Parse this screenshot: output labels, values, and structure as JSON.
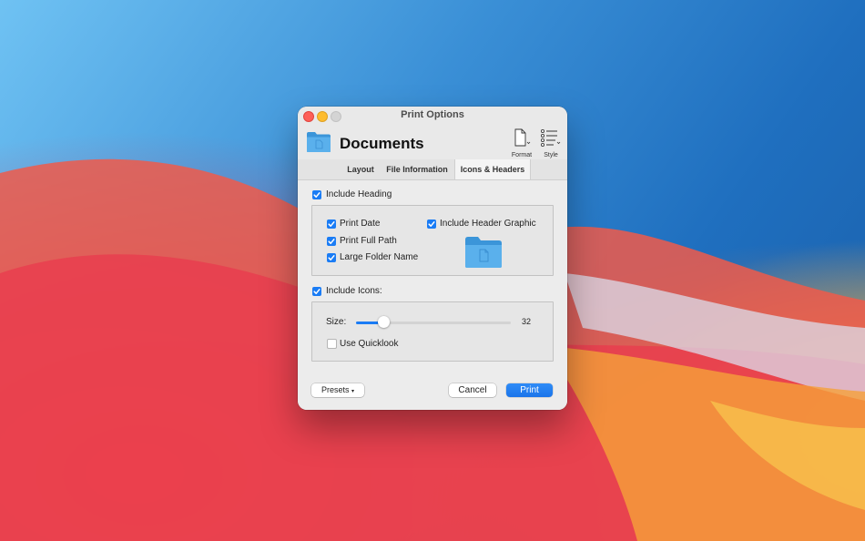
{
  "window": {
    "title": "Print Options",
    "header_title": "Documents",
    "toolbar": {
      "format_label": "Format",
      "style_label": "Style"
    }
  },
  "tabs": [
    {
      "label": "Layout",
      "selected": false
    },
    {
      "label": "File Information",
      "selected": false
    },
    {
      "label": "Icons & Headers",
      "selected": true
    }
  ],
  "heading": {
    "include_heading": {
      "label": "Include Heading",
      "checked": true
    },
    "print_date": {
      "label": "Print Date",
      "checked": true
    },
    "print_full_path": {
      "label": "Print Full Path",
      "checked": true
    },
    "large_folder_name": {
      "label": "Large Folder Name",
      "checked": true
    },
    "include_header_graphic": {
      "label": "Include Header Graphic",
      "checked": true
    }
  },
  "icons": {
    "include_icons": {
      "label": "Include Icons:",
      "checked": true
    },
    "size_label": "Size:",
    "size_value": "32",
    "size_fraction": 0.18,
    "use_quicklook": {
      "label": "Use Quicklook",
      "checked": false
    }
  },
  "buttons": {
    "presets": "Presets",
    "presets_arrow": "▾",
    "cancel": "Cancel",
    "print": "Print"
  },
  "colors": {
    "accent": "#1a7cf5",
    "folder": "#5ab0ec"
  }
}
